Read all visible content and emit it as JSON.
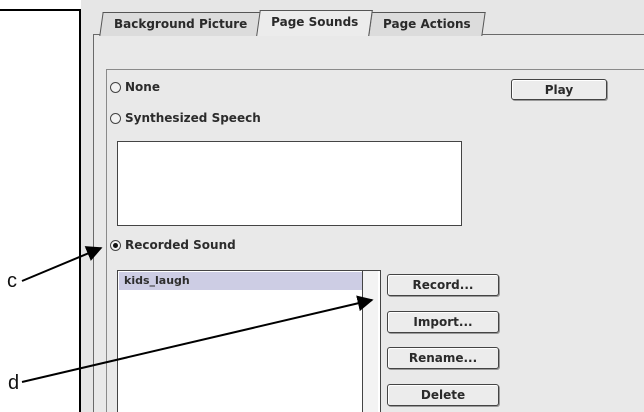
{
  "callouts": {
    "c": "c",
    "d": "d"
  },
  "tabs": [
    {
      "label": "Background Picture",
      "active": false
    },
    {
      "label": "Page Sounds",
      "active": true
    },
    {
      "label": "Page Actions",
      "active": false
    }
  ],
  "sound_options": {
    "none_label": "None",
    "synth_label": "Synthesized Speech",
    "recorded_label": "Recorded Sound",
    "selected": "Recorded Sound"
  },
  "buttons": {
    "play": "Play",
    "record": "Record...",
    "import": "Import...",
    "rename": "Rename...",
    "delete": "Delete"
  },
  "recorded_list": {
    "items": [
      "kids_laugh"
    ],
    "selected": "kids_laugh"
  },
  "colors": {
    "window_bg": "#e6e6e6",
    "selection": "#cdcde4"
  }
}
